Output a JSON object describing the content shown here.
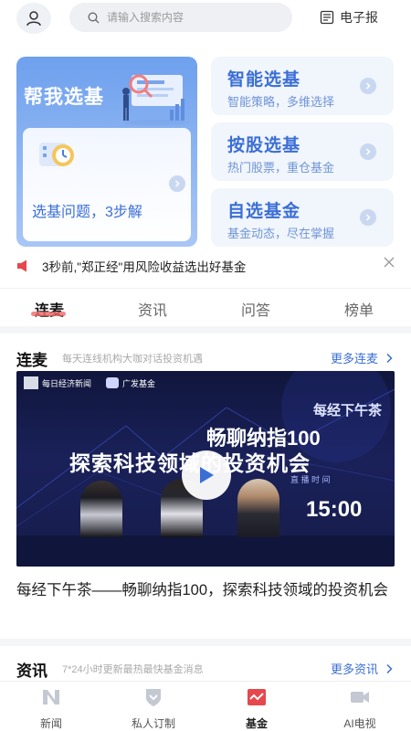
{
  "header": {
    "search_placeholder": "请输入搜索内容",
    "epaper_label": "电子报"
  },
  "hero": {
    "main_card": {
      "title": "帮我选基",
      "subtitle": "选基问题，3步解"
    },
    "cards": [
      {
        "title": "智能选基",
        "subtitle": "智能策略，多维选择"
      },
      {
        "title": "按股选基",
        "subtitle": "热门股票，重仓基金"
      },
      {
        "title": "自选基金",
        "subtitle": "基金动态，尽在掌握"
      }
    ]
  },
  "ticker": {
    "message": "3秒前,\"郑正经\"用风险收益选出好基金"
  },
  "tabs": [
    {
      "label": "连麦",
      "active": true
    },
    {
      "label": "资讯",
      "active": false
    },
    {
      "label": "问答",
      "active": false
    },
    {
      "label": "榜单",
      "active": false
    }
  ],
  "section_live": {
    "title": "连麦",
    "desc": "每天连线机构大咖对话投资机遇",
    "more": "更多连麦",
    "video": {
      "brand_left": "每日经济新闻",
      "brand_right": "广发基金",
      "top_line": "每经下午茶",
      "headline_1": "畅聊纳指100",
      "headline_2": "探索科技领域的投资机会",
      "date_text": "直 播 时 间",
      "time": "15:00"
    },
    "video_title": "每经下午茶——畅聊纳指100，探索科技领域的投资机会"
  },
  "section_news": {
    "title": "资讯",
    "desc": "7*24小时更新最热最快基金消息",
    "more": "更多资讯"
  },
  "bottom_nav": [
    {
      "label": "新闻",
      "active": false
    },
    {
      "label": "私人订制",
      "active": false
    },
    {
      "label": "基金",
      "active": true
    },
    {
      "label": "AI电视",
      "active": false
    }
  ],
  "colors": {
    "accent": "#3b6fd6",
    "active_nav": "#e5484d",
    "tab_underline": "#f06a6a"
  }
}
